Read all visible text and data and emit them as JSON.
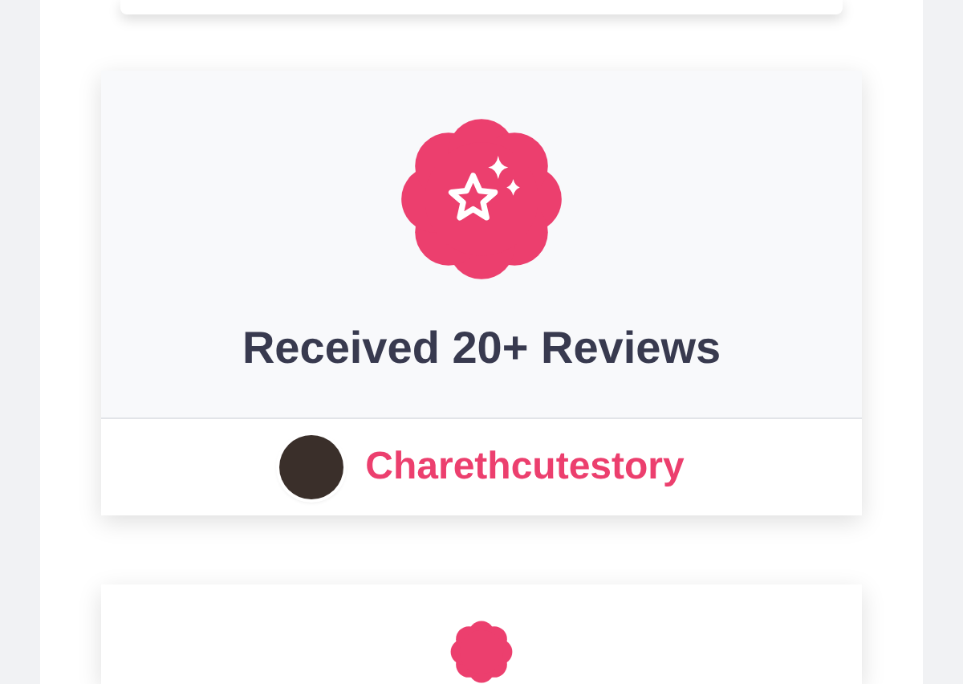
{
  "badge_card": {
    "title": "Received 20+ Reviews",
    "user": {
      "name": "Charethcutestory"
    }
  }
}
